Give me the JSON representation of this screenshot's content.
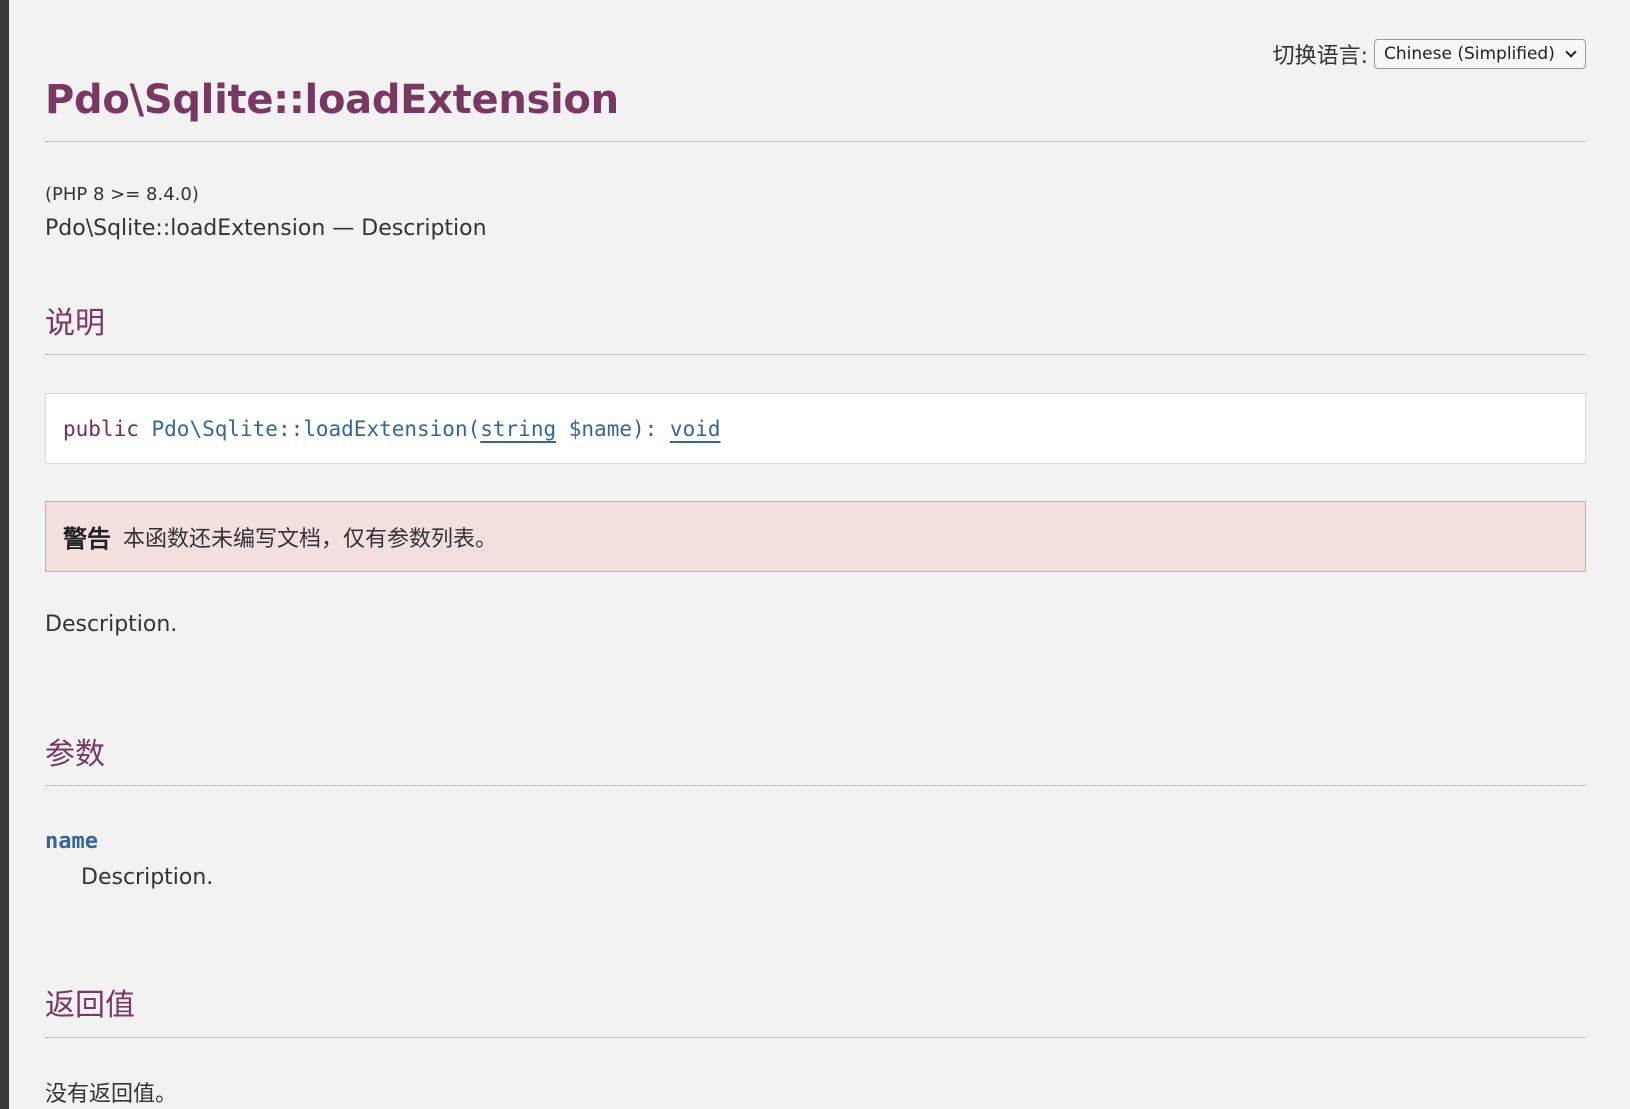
{
  "language_switch": {
    "label": "切换语言:",
    "selected": "Chinese (Simplified)"
  },
  "title": "Pdo\\Sqlite::loadExtension",
  "version": "(PHP 8 >= 8.4.0)",
  "refpurpose": "Pdo\\Sqlite::loadExtension — Description",
  "description_section": {
    "heading": "说明",
    "synopsis": {
      "modifier": "public",
      "method": "Pdo\\Sqlite::loadExtension",
      "open_paren": "(",
      "param_type": "string",
      "param_name": "$name",
      "close": "): ",
      "return_type": "void"
    },
    "warning": {
      "label": "警告",
      "text": "本函数还未编写文档，仅有参数列表。"
    },
    "text": "Description."
  },
  "parameters_section": {
    "heading": "参数",
    "param_name": "name",
    "param_desc": "Description."
  },
  "return_section": {
    "heading": "返回值",
    "text": "没有返回值。"
  },
  "colors": {
    "heading": "#793862",
    "link": "#336699",
    "background": "#f2f2f2",
    "warning_bg": "#f4dfdf"
  }
}
